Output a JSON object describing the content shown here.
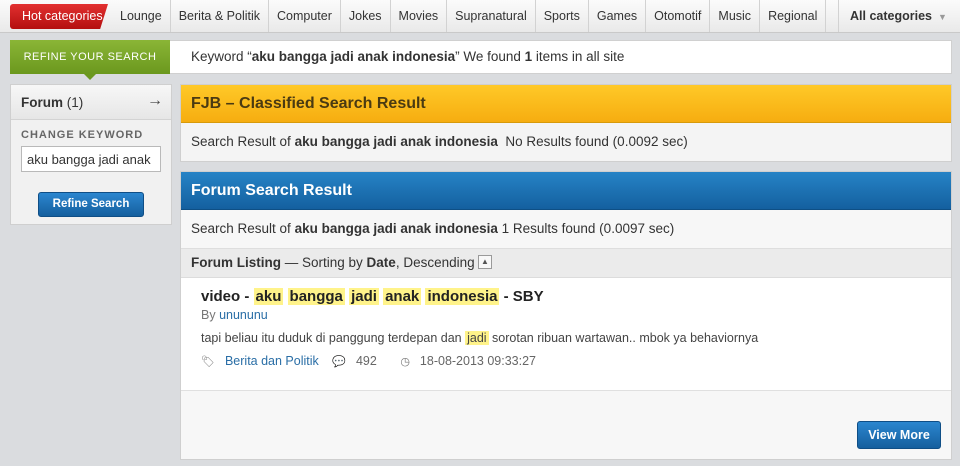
{
  "nav": {
    "hot_categories": "Hot categories",
    "items": [
      "Lounge",
      "Berita & Politik",
      "Computer",
      "Jokes",
      "Movies",
      "Supranatural",
      "Sports",
      "Games",
      "Otomotif",
      "Music",
      "Regional"
    ],
    "all_categories": "All categories"
  },
  "refine": {
    "tab_label": "REFINE YOUR SEARCH",
    "keyword_prefix": "Keyword “",
    "keyword": "aku bangga jadi anak indonesia",
    "found_middle": "” We found ",
    "found_count": "1",
    "found_suffix": " items in all site"
  },
  "sidebar": {
    "forum_label": "Forum",
    "forum_count": "(1)",
    "change_keyword": "CHANGE KEYWORD",
    "input_value": "aku bangga jadi anak i",
    "refine_button": "Refine Search"
  },
  "fjb": {
    "title": "FJB – Classified Search Result",
    "result_prefix": "Search Result of ",
    "query": "aku bangga jadi anak indonesia",
    "result_suffix": "  No Results found (0.0092 sec)"
  },
  "forum": {
    "title": "Forum Search Result",
    "result_prefix": "Search Result of ",
    "query": "aku bangga jadi anak indonesia",
    "result_suffix": " 1 Results found (0.0097 sec)",
    "listing_label": "Forum Listing",
    "sorting_text": " — Sorting by ",
    "sort_field": "Date",
    "sort_order": ", Descending",
    "results": [
      {
        "title_prefix": "video - ",
        "highlight": [
          "aku",
          "bangga",
          "jadi",
          "anak",
          "indonesia"
        ],
        "title_suffix": " - SBY",
        "by_label": "By ",
        "author": "unununu",
        "snippet_before": "tapi beliau itu duduk di panggung terdepan dan ",
        "snippet_highlight": "jadi",
        "snippet_after": " sorotan ribuan wartawan.. mbok ya behaviornya",
        "category": "Berita dan Politik",
        "comments": "492",
        "date": "18-08-2013 09:33:27"
      }
    ],
    "view_more": "View More"
  }
}
